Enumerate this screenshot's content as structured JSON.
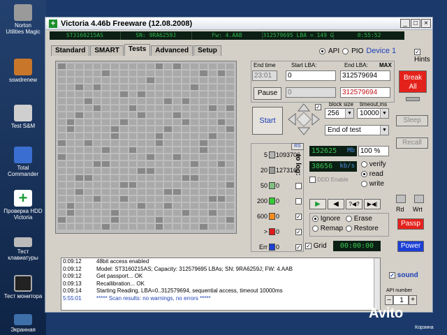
{
  "desktop": {
    "icons": [
      {
        "label": "Norton\nUtilities Magic",
        "color": "#aaaaaa"
      },
      {
        "label": "sswdrenew",
        "color": "#cc7722"
      },
      {
        "label": "Test S&M",
        "color": "#cc3333"
      },
      {
        "label": "Total\nCommander",
        "color": "#3366cc"
      },
      {
        "label": "Проверка HDD\nVictoria",
        "color": "#22aa44"
      },
      {
        "label": "Тест\nклавиатуры",
        "color": "#888888"
      },
      {
        "label": "Тест монитора",
        "color": "#222222"
      },
      {
        "label": "Экранная",
        "color": "#336699"
      }
    ]
  },
  "window": {
    "title": "Victoria 4.46b Freeware (12.08.2008)",
    "minimize": "_",
    "maximize": "□",
    "close": "×"
  },
  "infobar": {
    "model": "ST3160215AS",
    "serial": "SN: 9RA6259J",
    "firmware": "Fw: 4.AAB",
    "capacity": "312579695 LBA = 149 Gb",
    "time": "0:55:52"
  },
  "tabs": [
    "Standard",
    "SMART",
    "Tests",
    "Advanced",
    "Setup"
  ],
  "mode": {
    "api": "API",
    "pio": "PIO",
    "device": "Device 1",
    "hints": "Hints"
  },
  "tests": {
    "end_time_label": "End time",
    "end_time": "23:01",
    "start_lba_label": "Start LBA:",
    "start_lba": "0",
    "start_lba2": "0",
    "end_lba_label": "End LBA:",
    "max_label": "MAX",
    "end_lba": "312579694",
    "end_lba2": "312579694",
    "pause": "Pause",
    "start": "Start",
    "block_size_label": "block size",
    "block_size": "256",
    "timeout_label": "timeout,ms",
    "timeout": "10000",
    "end_of_test": "End of test",
    "break_all": "Break All",
    "sleep": "Sleep",
    "recall": "Recall",
    "rd": "Rd",
    "wrt": "Wrt",
    "passp": "Passp",
    "power": "Power",
    "rs": "RS",
    "to_log": "to log:",
    "ddd_enable": "DDD Enable",
    "speed": "152625",
    "speed_unit": "Mb",
    "percent": "100",
    "percent_unit": "%",
    "rate": "38656",
    "rate_unit": "kb/s",
    "verify": "verify",
    "read": "read",
    "write": "write",
    "ignore": "Ignore",
    "erase": "Erase",
    "remap": "Remap",
    "restore": "Restore",
    "grid": "Grid",
    "grid_time": "00:00:00",
    "transport": [
      "▶",
      "◀",
      "?◀?",
      "▶◀|"
    ]
  },
  "blocks": [
    {
      "label": "5",
      "count": "1093706",
      "color": "#b5b5b5"
    },
    {
      "label": "20",
      "count": "127310",
      "color": "#9a9a9a"
    },
    {
      "label": "50",
      "count": "0",
      "color": "#7fbf7f"
    },
    {
      "label": "200",
      "count": "0",
      "color": "#33cc33"
    },
    {
      "label": "600",
      "count": "0",
      "color": "#ff8c1a"
    },
    {
      "label": ">",
      "count": "0",
      "color": "#e01b1b"
    },
    {
      "label": "Err",
      "count": "0",
      "color": "#1c3fd6"
    }
  ],
  "log": [
    {
      "time": "0:09:12",
      "msg": "48bit access enabled",
      "hl": false
    },
    {
      "time": "0:09:12",
      "msg": "Model: ST3160215AS; Capacity: 312579695 LBAs; SN: 9RA6259J; FW: 4.AAB",
      "hl": false
    },
    {
      "time": "0:09:12",
      "msg": "Get passport... OK",
      "hl": false
    },
    {
      "time": "0:09:13",
      "msg": "Recallibration... OK",
      "hl": false
    },
    {
      "time": "0:09:14",
      "msg": "Starting Reading, LBA=0..312579694, sequential access, timeout 10000ms",
      "hl": false
    },
    {
      "time": "5:55:01",
      "msg": "***** Scan results: no warnings, no errors *****",
      "hl": true
    }
  ],
  "sound": {
    "label": "sound",
    "api_number_label": "API number",
    "api_number": "1",
    "minus": "–",
    "plus": "+"
  },
  "watermark": {
    "brand": "Avito",
    "sub": "Корзина"
  }
}
